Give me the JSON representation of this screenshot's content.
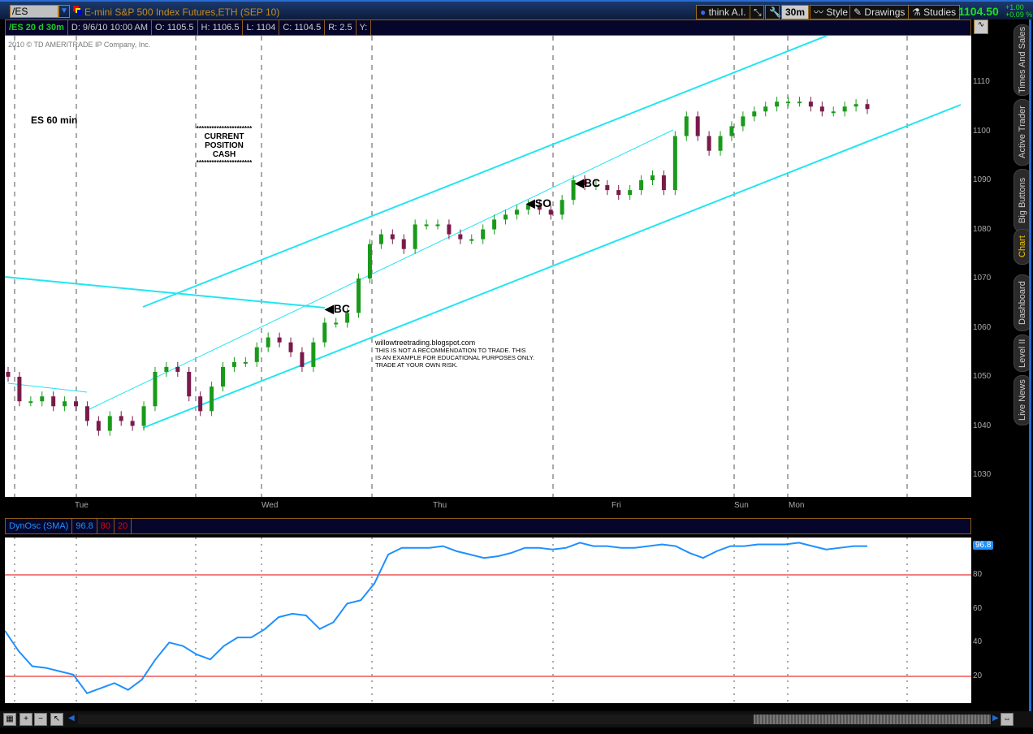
{
  "header": {
    "symbol": "/ES",
    "description": "E-mini S&P 500 Index Futures,ETH (SEP 10)",
    "think_ai": "think A.I.",
    "timeframe": "30m",
    "style": "Style",
    "drawings": "Drawings",
    "studies": "Studies",
    "last_price": "1104.50",
    "change": "+1.00",
    "change_pct": "+0.09 %"
  },
  "info": {
    "title": "/ES 20 d 30m",
    "date": "D: 9/6/10 10:00 AM",
    "open": "O: 1105.5",
    "high": "H: 1106.5",
    "low": "L: 1104",
    "close": "C: 1104.5",
    "range": "R: 2.5",
    "y": "Y:"
  },
  "copyright": "2010 © TD AMERITRADE IP Company, Inc.",
  "annotations": {
    "label": "ES 60 min",
    "stars": "**********************",
    "position": "CURRENT POSITION",
    "cash": "CASH",
    "site": "willowtreetrading.blogspot.com",
    "disclaimer1": "THIS IS NOT A RECOMMENDATION TO TRADE. THIS",
    "disclaimer2": "IS AN EXAMPLE FOR EDUCATIONAL PURPOSES ONLY.",
    "disclaimer3": "TRADE AT YOUR OWN RISK.",
    "bc1": "BC",
    "so": "SO",
    "bc2": "BC"
  },
  "osc_header": {
    "name": "DynOsc (SMA)",
    "value": "96.8",
    "upper": "80",
    "lower": "20"
  },
  "side_tabs": [
    "Times And Sales",
    "Active Trader",
    "Big Buttons",
    "Chart",
    "Dashboard",
    "Level II",
    "Live News"
  ],
  "colors": {
    "up": "#1a9a1a",
    "down": "#7a1a4a",
    "channel": "#22e5f0",
    "osc": "#1e90ff",
    "level": "#e00000"
  },
  "chart_data": [
    {
      "type": "candlestick",
      "title": "/ES 20 d 30m",
      "x_labels": [
        "Tue",
        "Wed",
        "Thu",
        "Fri",
        "Sun",
        "Mon"
      ],
      "y_ticks": [
        1030,
        1040,
        1050,
        1060,
        1070,
        1080,
        1090,
        1100,
        1110
      ],
      "ylim": [
        1025,
        1120
      ],
      "closes": [
        1050,
        1045,
        1045,
        1046,
        1044,
        1045,
        1044,
        1041,
        1039,
        1042,
        1041,
        1040,
        1044,
        1051,
        1052,
        1051,
        1046,
        1043,
        1048,
        1052,
        1053,
        1053,
        1056,
        1058,
        1057,
        1055,
        1052,
        1057,
        1061,
        1061,
        1063,
        1070,
        1077,
        1079,
        1078,
        1076,
        1081,
        1081,
        1081,
        1079,
        1078,
        1078,
        1080,
        1082,
        1083,
        1084,
        1085,
        1084,
        1083,
        1086,
        1090,
        1089,
        1089,
        1088,
        1087,
        1088,
        1090,
        1091,
        1088,
        1099,
        1103,
        1099,
        1096,
        1099,
        1101,
        1103,
        1104,
        1105,
        1106,
        1106,
        1106,
        1105,
        1104,
        1104,
        1105,
        1105.5,
        1104.5
      ]
    },
    {
      "type": "line",
      "title": "DynOsc (SMA)",
      "y_ticks": [
        20,
        40,
        60,
        80
      ],
      "ylim": [
        0,
        100
      ],
      "levels": [
        80,
        20
      ],
      "current": 96.8,
      "values": [
        47,
        35,
        26,
        25,
        23,
        21,
        10,
        13,
        16,
        12,
        18,
        30,
        40,
        38,
        33,
        30,
        38,
        43,
        43,
        48,
        55,
        57,
        56,
        48,
        52,
        63,
        65,
        75,
        92,
        96,
        96,
        96,
        97,
        94,
        92,
        90,
        91,
        93,
        96,
        96,
        95,
        96,
        99,
        97,
        97,
        96,
        96,
        97,
        98,
        97,
        93,
        90,
        94,
        97,
        97,
        98,
        98,
        98,
        99,
        97,
        95,
        96,
        97,
        97
      ]
    }
  ]
}
